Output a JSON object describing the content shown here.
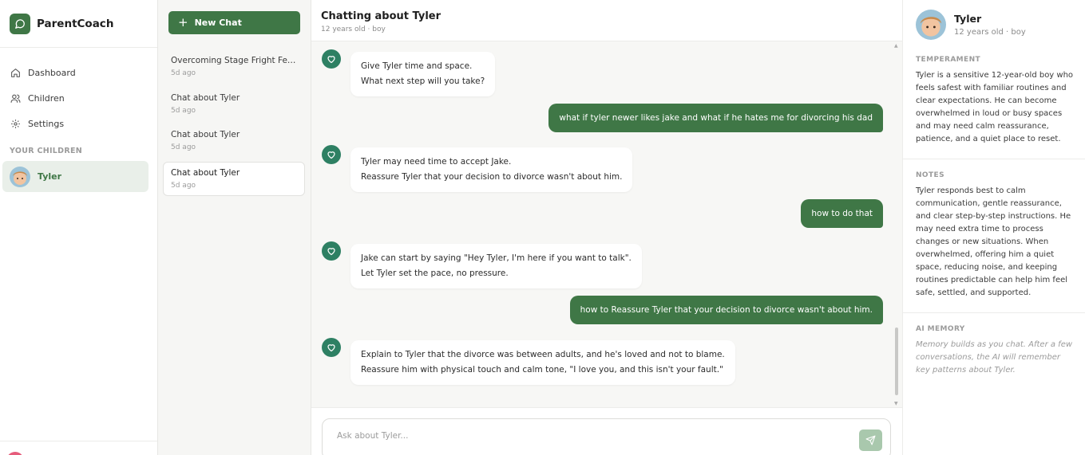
{
  "brand": {
    "name": "ParentCoach",
    "icon": "chat-bubble-icon",
    "accent": "#3f7746"
  },
  "nav": [
    {
      "label": "Dashboard",
      "icon": "home-icon"
    },
    {
      "label": "Children",
      "icon": "users-icon"
    },
    {
      "label": "Settings",
      "icon": "gear-icon"
    }
  ],
  "children_section": {
    "label": "YOUR CHILDREN",
    "items": [
      {
        "name": "Tyler"
      }
    ]
  },
  "chatlist": {
    "new_chat_label": "New Chat",
    "items": [
      {
        "title": "Overcoming Stage Fright Fea...",
        "time": "5d ago"
      },
      {
        "title": "Chat about Tyler",
        "time": "5d ago"
      },
      {
        "title": "Chat about Tyler",
        "time": "5d ago"
      },
      {
        "title": "Chat about Tyler",
        "time": "5d ago"
      }
    ]
  },
  "chat": {
    "title": "Chatting about Tyler",
    "subtitle": "12 years old · boy",
    "messages": [
      {
        "role": "bot",
        "lines": [
          "Give Tyler time and space.",
          "What next step will you take?"
        ]
      },
      {
        "role": "user",
        "text": "what if tyler newer likes jake and what if he hates me for divorcing his dad"
      },
      {
        "role": "bot",
        "lines": [
          "Tyler may need time to accept Jake.",
          "Reassure Tyler that your decision to divorce wasn't about him."
        ]
      },
      {
        "role": "user",
        "text": "how to do that"
      },
      {
        "role": "bot",
        "lines": [
          "Jake can start by saying \"Hey Tyler, I'm here if you want to talk\".",
          "Let Tyler set the pace, no pressure."
        ]
      },
      {
        "role": "user",
        "text": "how to Reassure Tyler that your decision to divorce wasn't about him."
      },
      {
        "role": "bot",
        "lines": [
          "Explain to Tyler that the divorce was between adults, and he's loved and not to blame.",
          "Reassure him with physical touch and calm tone, \"I love you, and this isn't your fault.\""
        ]
      }
    ],
    "input_placeholder": "Ask about Tyler..."
  },
  "profile": {
    "name": "Tyler",
    "subtitle": "12 years old · boy",
    "temperament_title": "TEMPERAMENT",
    "temperament": "Tyler is a sensitive 12-year-old boy who feels safest with familiar routines and clear expectations. He can become overwhelmed in loud or busy spaces and may need calm reassurance, patience, and a quiet place to reset.",
    "notes_title": "NOTES",
    "notes": "Tyler responds best to calm communication, gentle reassurance, and clear step-by-step instructions. He may need extra time to process changes or new situations. When overwhelmed, offering him a quiet space, reducing noise, and keeping routines predictable can help him feel safe, settled, and supported.",
    "memory_title": "AI MEMORY",
    "memory": "Memory builds as you chat. After a few conversations, the AI will remember key patterns about Tyler."
  }
}
